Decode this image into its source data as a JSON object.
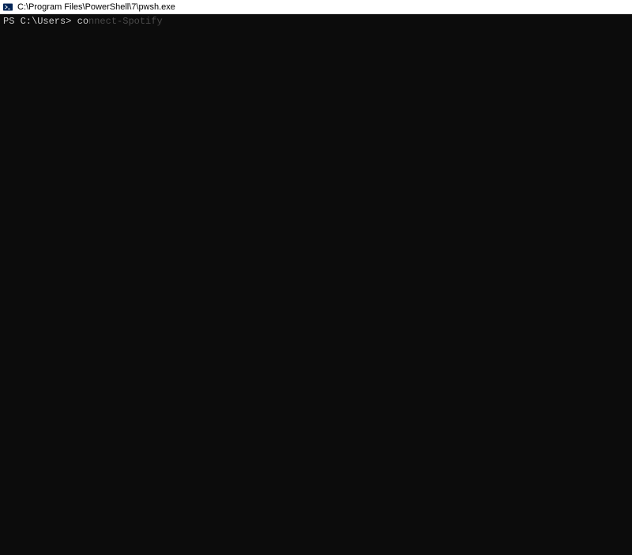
{
  "titlebar": {
    "title": "C:\\Program Files\\PowerShell\\7\\pwsh.exe"
  },
  "terminal": {
    "prompt": "PS C:\\Users> ",
    "typed": "co",
    "suggestion": "nnect-Spotify"
  }
}
